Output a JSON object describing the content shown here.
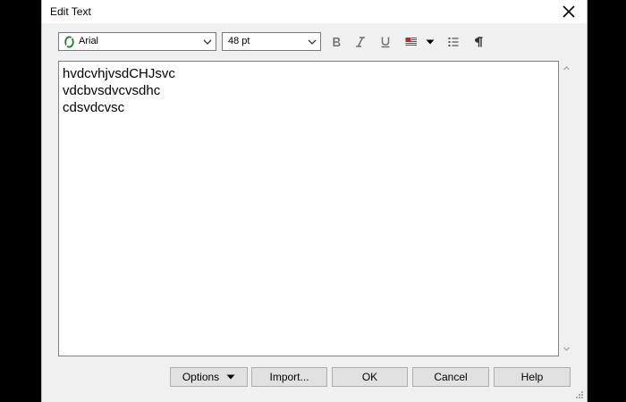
{
  "dialog": {
    "title": "Edit Text"
  },
  "toolbar": {
    "font_name": "Arial",
    "font_size": "48 pt",
    "icons": [
      "bold-icon",
      "italic-icon",
      "underline-icon",
      "text-color-icon",
      "dropdown-arrow-icon",
      "bullet-list-icon",
      "paragraph-icon"
    ]
  },
  "editor": {
    "text": "hvdcvhjvsdCHJsvc\nvdcbvsdvcvsdhc\ncdsvdcvsc"
  },
  "buttons": {
    "options": "Options",
    "import": "Import...",
    "ok": "OK",
    "cancel": "Cancel",
    "help": "Help"
  },
  "colors": {
    "text_color_swatch": "#c0282d",
    "close_icon": "#000000"
  }
}
